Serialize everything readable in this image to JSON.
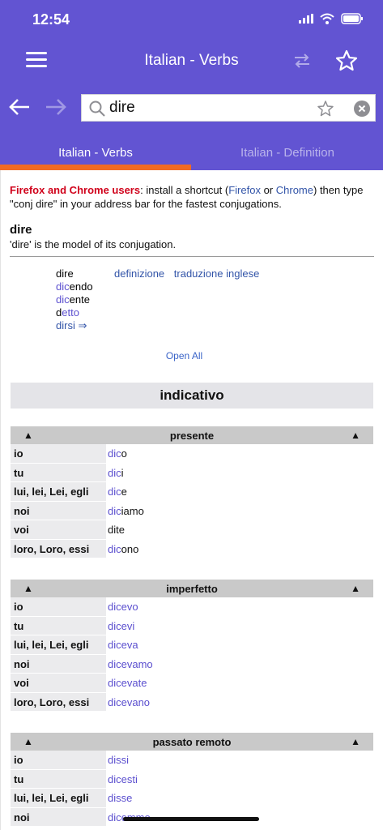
{
  "status": {
    "time": "12:54"
  },
  "nav": {
    "title": "Italian - Verbs"
  },
  "search": {
    "value": "dire",
    "placeholder": ""
  },
  "tabs": [
    {
      "label": "Italian - Verbs"
    },
    {
      "label": "Italian - Definition"
    }
  ],
  "notice": {
    "lead": "Firefox and Chrome users",
    "part1": ": install a shortcut (",
    "firefox": "Firefox",
    "or": " or ",
    "chrome": "Chrome",
    "part2": ") then type \"conj dire\" in your address bar for the fastest conjugations."
  },
  "verb": {
    "infinitive": "dire",
    "model_note": "'dire' is the model of its conjugation."
  },
  "forms": {
    "infinitive": "dire",
    "gerund": {
      "stem": "dic",
      "ending": "endo"
    },
    "participle_present": {
      "stem": "dic",
      "ending": "ente"
    },
    "participle_past": {
      "stem": "d",
      "ending": "etto"
    },
    "reflexive": "dirsi ⇒"
  },
  "links": {
    "definition": "definizione",
    "translation": "traduzione inglese"
  },
  "open_all": "Open All",
  "mood": "indicativo",
  "colors": {
    "header": "#6254d2",
    "accent": "#f06a24",
    "stem": "#5b4fcf"
  },
  "tenses": [
    {
      "name": "presente",
      "rows": [
        {
          "pronoun": "io",
          "stem": "dic",
          "ending": "o"
        },
        {
          "pronoun": "tu",
          "stem": "dic",
          "ending": "i"
        },
        {
          "pronoun": "lui, lei, Lei, egli",
          "stem": "dic",
          "ending": "e"
        },
        {
          "pronoun": "noi",
          "stem": "dic",
          "ending": "iamo"
        },
        {
          "pronoun": "voi",
          "stem": "",
          "ending": "dite"
        },
        {
          "pronoun": "loro, Loro, essi",
          "stem": "dic",
          "ending": "ono"
        }
      ]
    },
    {
      "name": "imperfetto",
      "rows": [
        {
          "pronoun": "io",
          "stem": "dicevo",
          "ending": ""
        },
        {
          "pronoun": "tu",
          "stem": "dicevi",
          "ending": ""
        },
        {
          "pronoun": "lui, lei, Lei, egli",
          "stem": "diceva",
          "ending": ""
        },
        {
          "pronoun": "noi",
          "stem": "dicevamo",
          "ending": ""
        },
        {
          "pronoun": "voi",
          "stem": "dicevate",
          "ending": ""
        },
        {
          "pronoun": "loro, Loro, essi",
          "stem": "dicevano",
          "ending": ""
        }
      ]
    },
    {
      "name": "passato remoto",
      "rows": [
        {
          "pronoun": "io",
          "stem": "dissi",
          "ending": ""
        },
        {
          "pronoun": "tu",
          "stem": "dicesti",
          "ending": ""
        },
        {
          "pronoun": "lui, lei, Lei, egli",
          "stem": "disse",
          "ending": ""
        },
        {
          "pronoun": "noi",
          "stem": "dicemmo",
          "ending": ""
        }
      ]
    }
  ]
}
